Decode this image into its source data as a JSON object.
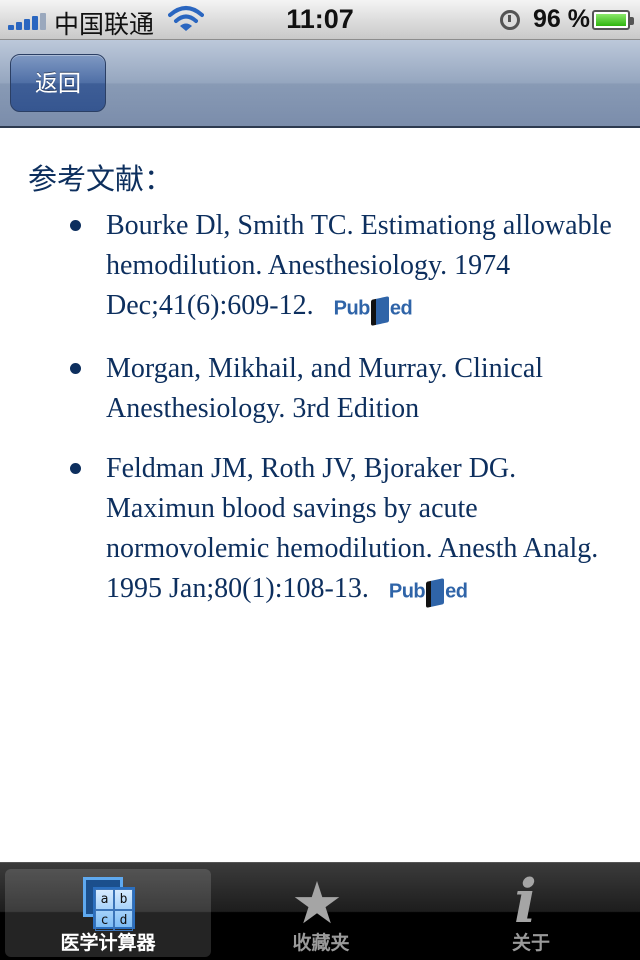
{
  "status_bar": {
    "carrier": "中国联通",
    "time": "11:07",
    "battery_percent": "96 %",
    "icons": [
      "signal-icon",
      "wifi-icon",
      "alarm-icon",
      "battery-icon"
    ]
  },
  "nav_bar": {
    "back_label": "返回"
  },
  "content": {
    "heading": "参考文献：",
    "references": [
      {
        "text": "Bourke Dl, Smith TC. Estimationg allowable hemodilution. Anesthesiology. 1974 Dec;41(6):609-12.",
        "link_pre": "Pub",
        "link_post": "ed"
      },
      {
        "text": "Morgan, Mikhail, and Murray. Clinical Anesthesiology. 3rd Edition"
      },
      {
        "text": "Feldman JM, Roth JV, Bjoraker DG. Maximun blood savings by acute normovolemic hemodilution. Anesth Analg. 1995 Jan;80(1):108-13.",
        "link_pre": "Pub",
        "link_post": "ed"
      }
    ]
  },
  "tab_bar": {
    "tabs": [
      {
        "label": "医学计算器",
        "icon": "calculator-icon",
        "active": true,
        "glyphs": [
          "a",
          "b",
          "c",
          "d"
        ]
      },
      {
        "label": "收藏夹",
        "icon": "star-icon",
        "active": false
      },
      {
        "label": "关于",
        "icon": "info-icon",
        "active": false
      }
    ]
  },
  "colors": {
    "accent_text": "#0d2f5e",
    "navbar": "#8a9cb7",
    "tabbar": "#000000"
  }
}
